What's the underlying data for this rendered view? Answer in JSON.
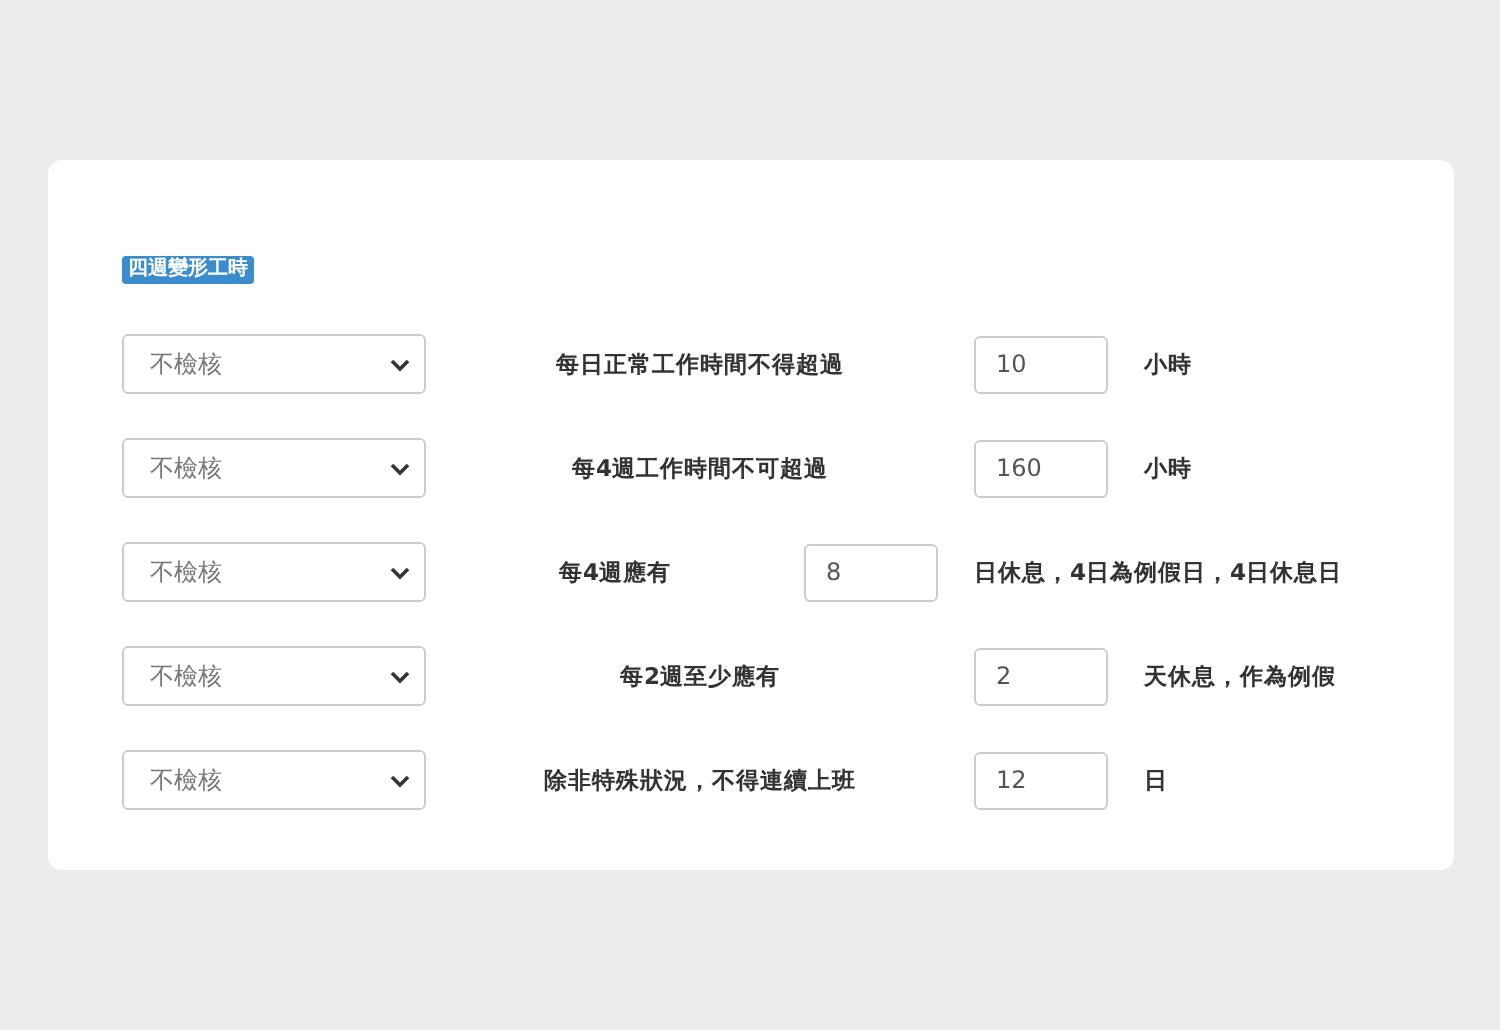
{
  "badge": "四週變形工時",
  "rows": [
    {
      "kind": "standard",
      "select": "不檢核",
      "label": "每日正常工作時間不得超過",
      "value": "10",
      "unit": "小時"
    },
    {
      "kind": "standard",
      "select": "不檢核",
      "label": "每4週工作時間不可超過",
      "value": "160",
      "unit": "小時"
    },
    {
      "kind": "compact",
      "select": "不檢核",
      "label": "每4週應有",
      "value": "8",
      "unit": "日休息，4日為例假日，4日休息日"
    },
    {
      "kind": "standard",
      "select": "不檢核",
      "label": "每2週至少應有",
      "value": "2",
      "unit": "天休息，作為例假"
    },
    {
      "kind": "standard",
      "select": "不檢核",
      "label": "除非特殊狀況，不得連續上班",
      "value": "12",
      "unit": "日"
    }
  ]
}
